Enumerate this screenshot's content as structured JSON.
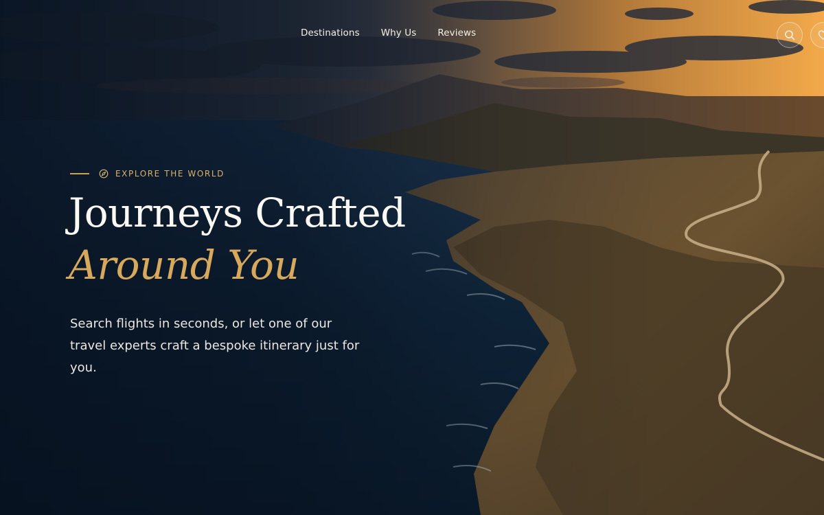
{
  "nav": {
    "links": [
      "Destinations",
      "Why Us",
      "Reviews"
    ],
    "search_icon": "search-icon",
    "wishlist_icon": "heart-icon"
  },
  "hero": {
    "eyebrow_icon": "compass-icon",
    "eyebrow": "EXPLORE THE WORLD",
    "title_line1": "Journeys Crafted",
    "title_line2": "Around You",
    "subtitle": "Search flights in seconds, or let one of our travel experts craft a bespoke itinerary just for you."
  },
  "colors": {
    "accent": "#d6a95c",
    "eyebrow": "#d8b36c",
    "text": "#fbf9f4"
  }
}
